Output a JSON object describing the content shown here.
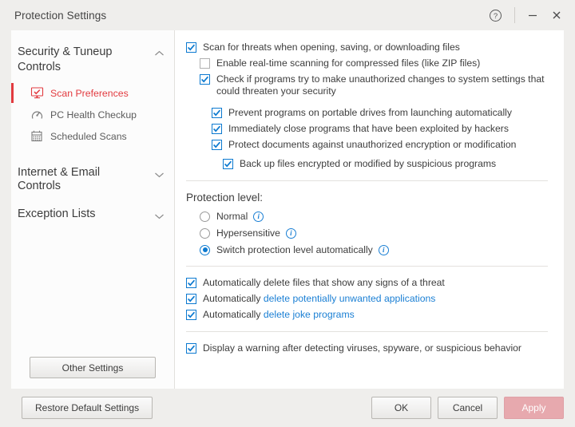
{
  "window": {
    "title": "Protection Settings",
    "controls": [
      {
        "name": "help-icon",
        "label": "?"
      },
      {
        "name": "minimize-icon",
        "label": "–"
      },
      {
        "name": "close-icon",
        "label": "✕"
      }
    ]
  },
  "sidebar": {
    "sections": [
      {
        "title": "Security & Tuneup Controls",
        "expanded": true,
        "chevron": "chevron-up-icon",
        "items": [
          {
            "label": "Scan Preferences",
            "icon": "monitor-check-icon",
            "active": true
          },
          {
            "label": "PC Health Checkup",
            "icon": "gauge-icon",
            "active": false
          },
          {
            "label": "Scheduled Scans",
            "icon": "calendar-icon",
            "active": false
          }
        ]
      },
      {
        "title": "Internet & Email Controls",
        "expanded": false,
        "chevron": "chevron-down-icon",
        "items": []
      },
      {
        "title": "Exception Lists",
        "expanded": false,
        "chevron": "chevron-down-icon",
        "items": []
      }
    ],
    "other_settings_label": "Other Settings"
  },
  "content": {
    "top_group": [
      {
        "label": "Scan for threats when opening, saving, or downloading files",
        "checked": true,
        "indent": 0
      },
      {
        "label": "Enable real-time scanning for compressed files (like ZIP files)",
        "checked": false,
        "indent": 1
      },
      {
        "label": "Check if programs try to make unauthorized changes to system settings that could threaten your security",
        "checked": true,
        "indent": 1
      },
      {
        "label": "Prevent programs on portable drives from launching automatically",
        "checked": true,
        "indent": 2
      },
      {
        "label": "Immediately close programs that have been exploited by hackers",
        "checked": true,
        "indent": 2
      },
      {
        "label": "Protect documents against unauthorized encryption or modification",
        "checked": true,
        "indent": 2
      },
      {
        "label": "Back up files encrypted or modified by suspicious programs",
        "checked": true,
        "indent": 3
      }
    ],
    "protection_level": {
      "heading": "Protection level:",
      "options": [
        {
          "label": "Normal",
          "selected": false,
          "info": "info-icon"
        },
        {
          "label": "Hypersensitive",
          "selected": false,
          "info": "info-icon"
        },
        {
          "label": "Switch protection level automatically",
          "selected": true,
          "info": "info-icon"
        }
      ]
    },
    "auto_delete_group": [
      {
        "prefix": "Automatically delete files that show any signs of a threat",
        "link": "",
        "checked": true
      },
      {
        "prefix": "Automatically ",
        "link": "delete potentially unwanted applications",
        "checked": true
      },
      {
        "prefix": "Automatically ",
        "link": "delete joke programs",
        "checked": true
      }
    ],
    "warning_group": [
      {
        "label": "Display a warning after detecting viruses, spyware, or suspicious behavior",
        "checked": true
      }
    ]
  },
  "footer": {
    "restore_label": "Restore Default Settings",
    "ok_label": "OK",
    "cancel_label": "Cancel",
    "apply_label": "Apply"
  },
  "colors": {
    "accent_red": "#e23a3f",
    "link_blue": "#1a7fd4",
    "checkbox_blue": "#0b79d0",
    "apply_pink": "#e7a9ae"
  }
}
